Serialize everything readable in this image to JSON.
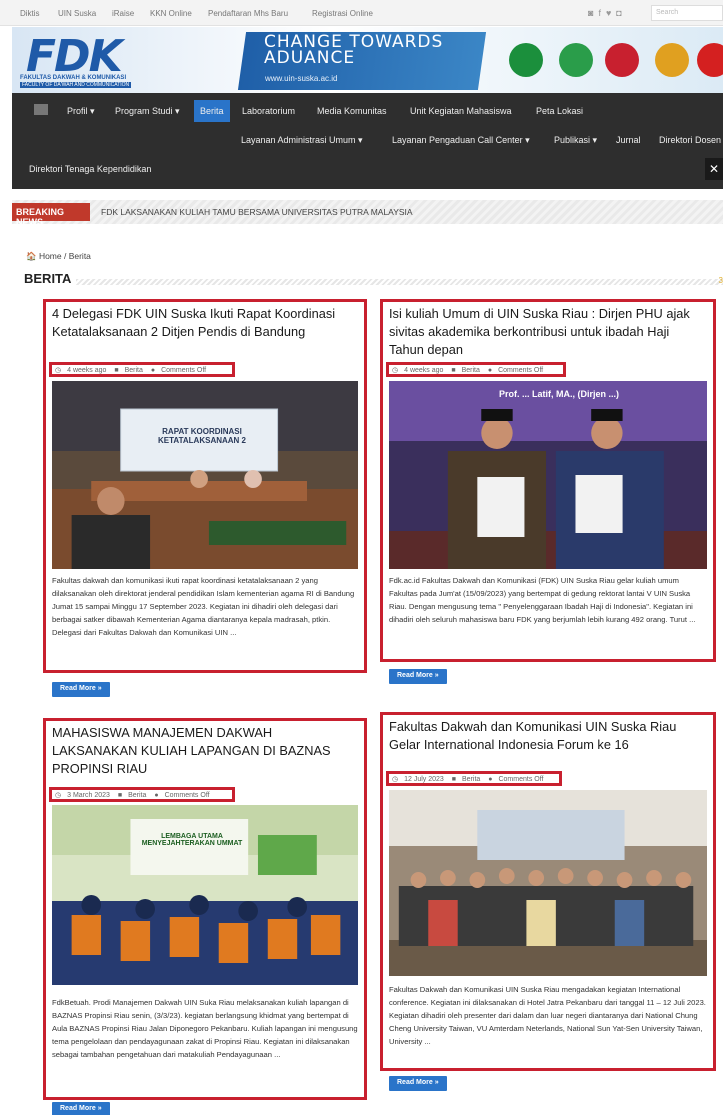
{
  "topbar": {
    "links": [
      "Diktis",
      "UIN Suska",
      "iRaise",
      "KKN Online",
      "Pendaftaran Mhs Baru",
      "Registrasi Online"
    ],
    "social_icons": [
      "rss-icon",
      "facebook-icon",
      "twitter-icon",
      "instagram-icon"
    ],
    "search_placeholder": "Search"
  },
  "header": {
    "logo_text": "FDK",
    "logo_sub1": "FAKULTAS DAKWAH & KOMUNIKASI",
    "logo_sub2": "FACULTY OF DA'WAH AND COMMUNICATION",
    "slogan_line1": "CHANGE TOWARDS",
    "slogan_line2": "ADUANCE",
    "site_url": "www.uin-suska.ac.id",
    "partner_colors": [
      "#1b8f3c",
      "#2a9d4a",
      "#c8202f",
      "#e0a020",
      "#d42020"
    ]
  },
  "nav": {
    "row1": [
      "Profil ▾",
      "Program Studi ▾",
      "Berita",
      "Laboratorium",
      "Media Komunitas",
      "Unit Kegiatan Mahasiswa",
      "Peta Lokasi"
    ],
    "row2": [
      "Layanan Administrasi Umum ▾",
      "Layanan Pengaduan Call Center ▾",
      "Publikasi ▾",
      "Jurnal",
      "Direktori Dosen"
    ],
    "row3": [
      "Direktori Tenaga Kependidikan"
    ],
    "active": "Berita",
    "shuffle": "✕"
  },
  "breaking": {
    "tag": "BREAKING NEWS",
    "text": "FDK LAKSANAKAN KULIAH TAMU BERSAMA UNIVERSITAS PUTRA MALAYSIA"
  },
  "breadcrumb": "🏠 Home / Berita",
  "section_title": "BERITA",
  "meta_labels": {
    "category": "Berita",
    "comments": "Comments Off"
  },
  "read_more": "Read More »",
  "posts": [
    {
      "title": "4 Delegasi FDK UIN Suska Ikuti Rapat Koordinasi Ketatalaksanaan 2 Ditjen Pendis di Bandung",
      "date": "4 weeks ago",
      "banner_text": "RAPAT KOORDINASI KETATALAKSANAAN 2",
      "excerpt": "Fakultas dakwah dan komunikasi ikuti rapat koordinasi ketatalaksanaan 2 yang dilaksanakan oleh direktorat jenderal pendidikan Islam kementerian agama RI di Bandung Jumat 15 sampai Minggu 17 September 2023. Kegiatan ini dihadiri oleh delegasi dari berbagai satker dibawah Kementerian Agama diantaranya kepala madrasah, ptkin. Delegasi dari Fakultas Dakwah dan Komunikasi UIN ..."
    },
    {
      "title": "Isi kuliah Umum di UIN Suska Riau : Dirjen PHU ajak sivitas akademika berkontribusi untuk ibadah Haji Tahun depan",
      "date": "4 weeks ago",
      "banner_text": "Prof. ... Latif, MA., (Dirjen ...)",
      "excerpt": "Fdk.ac.id Fakultas Dakwah dan Komunikasi (FDK) UIN Suska Riau gelar kuliah umum Fakultas pada Jum'at (15/09/2023) yang bertempat di gedung rektorat lantai V UIN Suska Riau. Dengan mengusung tema \" Penyelenggaraan Ibadah Haji di Indonesia\". Kegiatan ini dihadiri oleh seluruh mahasiswa baru FDK yang berjumlah lebih kurang 492 orang. Turut ..."
    },
    {
      "title": "MAHASISWA MANAJEMEN DAKWAH LAKSANAKAN KULIAH LAPANGAN DI BAZNAS PROPINSI RIAU",
      "date": "3 March 2023",
      "banner_text": "LEMBAGA UTAMA MENYEJAHTERAKAN UMMAT",
      "excerpt": "FdkBetuah. Prodi Manajemen Dakwah UIN Suka Riau melaksanakan kuliah lapangan di BAZNAS Propinsi Riau senin, (3/3/23). kegiatan berlangsung khidmat yang bertempat di Aula BAZNAS Propinsi Riau Jalan Diponegoro Pekanbaru. Kuliah lapangan ini mengusung tema pengelolaan dan pendayagunaan zakat di Propinsi Riau. Kegiatan ini dilaksanakan sebagai tambahan pengetahuan dari matakuliah Pendayagunaan ..."
    },
    {
      "title": "Fakultas Dakwah dan Komunikasi UIN Suska Riau Gelar International Indonesia Forum ke 16",
      "date": "12 July 2023",
      "banner_text": "",
      "excerpt": "Fakultas Dakwah dan Komunikasi UIN Suska Riau mengadakan kegiatan International conference. Kegiatan ini dilaksanakan di Hotel Jatra Pekanbaru dari tanggal 11 – 12 Juli 2023. Kegiatan dihadiri oleh presenter dari dalam dan luar negeri diantaranya dari National Chung Cheng University Taiwan, VU Amterdam Neterlands, National Sun Yat-Sen University Taiwan, University ..."
    }
  ]
}
